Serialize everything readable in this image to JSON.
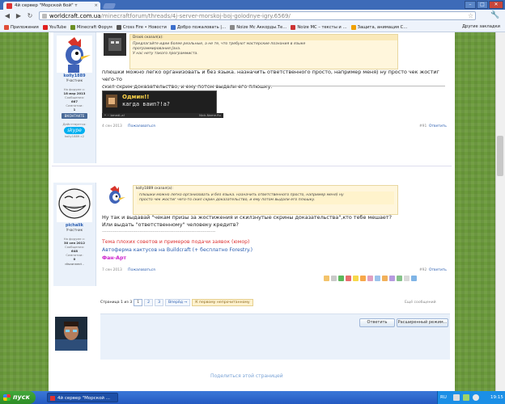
{
  "browser": {
    "tab_title": "4й сервер \"Морской бой\" т",
    "tab_close": "×",
    "url_host": "worldcraft.com.ua",
    "url_path": "/minecraftforum/threads/4j-server-morskoj-boj-golodnye-igry.6569/",
    "win_min": "–",
    "win_max": "□",
    "win_close": "✕",
    "back": "◀",
    "forward": "▶",
    "reload": "↻",
    "star": "☆",
    "wrench": "🔧"
  },
  "bookmarks": [
    {
      "label": "Приложения",
      "color": "#e04e39"
    },
    {
      "label": "YouTube",
      "color": "#e02020"
    },
    {
      "label": "Minecraft Форум",
      "color": "#6b8e23"
    },
    {
      "label": "Cross Fire • Новости",
      "color": "#555555"
    },
    {
      "label": "Добро пожаловать |…",
      "color": "#3b6ecc"
    },
    {
      "label": "Noize Mc Аккорды.Те…",
      "color": "#888888"
    },
    {
      "label": "Noize MC – тексты и …",
      "color": "#cc3333"
    },
    {
      "label": "Защита, анимация С…",
      "color": "#f0a000"
    }
  ],
  "bookmarks_other": "Другие закладки",
  "post1": {
    "username": "kolly1889",
    "user_title": "Участник",
    "label_reg": "На форуме с:",
    "reg_date": "18 мар 2013",
    "label_msgs": "Сообщения:",
    "msgs": "667",
    "label_likes": "Симпатии:",
    "likes": "1",
    "vk": "ВКОНТАКТЕ",
    "skype": "skype",
    "label_home": "Дейсттвуетca:",
    "skype_name": "kolly1889 c2",
    "quote_header": "Drook сказал(а):",
    "quote_line1": "Предлагайте идеи более реальные, а не те, что требуют мастерские познания в языке",
    "quote_line2": "программирования Java.",
    "quote_line3": "У нас нету такого программиста.",
    "text_line1": "плюшки можно легко организовать и без языка. назначить ответственного просто, например меня) ну просто чек жостиг чего-то",
    "text_line2": "скил скрин доказательство, и ему потом выдали его плюшку.",
    "banner_line1": "Одмин!!",
    "banner_line2": "кагда ваип?!а?",
    "banner_caption_left": "*  ~ bmedi–a!",
    "banner_caption_right": "Nick-Name.Ru",
    "date": "4 сен 2013",
    "complain": "Пожаловаться",
    "num": "#91",
    "reply": "Ответить"
  },
  "post2": {
    "username": "pichalik",
    "user_title": "Участник",
    "label_reg": "На форуме с:",
    "reg_date": "30 сен 2012",
    "label_msgs": "Сообщения:",
    "msgs": "648",
    "label_likes": "Симпатии:",
    "likes": "0",
    "status": "disconnect -",
    "quote_header": "kolly1889 сказал(а):",
    "quote_line1": "плюшки можно легко организовать и без языка. назначить ответственного просто, например меня) ну",
    "quote_line2": "просто чек жостиг чего-то скил скрин доказательство, и ему потом выдали его плюшку.",
    "text_line1": "Ну так и выдавай \"чекам призы за жостижения и скилзнутые скрины доказательства\",кто тебе мешает?",
    "text_line2": "Или выдать \"ответственному\" человеку кредитв?",
    "sig_sep": "---------------------------------------------------------------------------------",
    "sig_line1": "Тема плохих советов и примеров подачи заявок (юмор)",
    "sig_line2": "Автоферма кактусов на Buildcraft (+ бесплатно Forestry.)",
    "sig_line3": "Фан-Арт",
    "date": "7 сен 2013",
    "complain": "Пожаловаться",
    "num": "#92",
    "reply": "Ответить"
  },
  "pager": {
    "label": "Страница 1 из 3",
    "pages": [
      "1",
      "2",
      "3"
    ],
    "next": "Вперёд →",
    "first_unread": "К первому непрочитанному"
  },
  "more_msgs": "Ещё сообщений",
  "reply_box": {
    "reply_btn": "Ответить",
    "advanced_btn": "Расширенный режим..."
  },
  "share_link": "Поделиться этой страницей",
  "taskbar": {
    "start": "пуск",
    "task_title": "4й сервер \"Морской ...",
    "lang": "RU",
    "clock": "19:15"
  },
  "colors": {
    "accent_link": "#2a5db0",
    "sig_red": "#d33",
    "sig_blue": "#2a5db0"
  }
}
